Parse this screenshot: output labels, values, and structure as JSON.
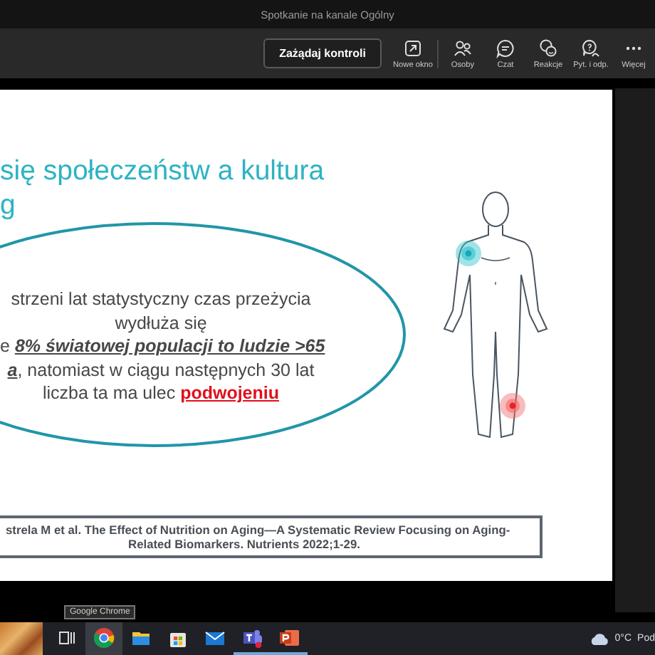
{
  "window": {
    "title": "Spotkanie na kanale Ogólny"
  },
  "toolbar": {
    "control_button": "Zażądaj kontroli",
    "actions": [
      {
        "kind": "new-window",
        "label": "Nowe okno"
      },
      {
        "kind": "people",
        "label": "Osoby"
      },
      {
        "kind": "chat",
        "label": "Czat"
      },
      {
        "kind": "reactions",
        "label": "Reakcje"
      },
      {
        "kind": "qa",
        "label": "Pyt. i odp."
      },
      {
        "kind": "more",
        "label": "Więcej"
      }
    ]
  },
  "slide": {
    "title_lines": [
      "się społeczeństw a kultura",
      "g"
    ],
    "body_lines": [
      [
        {
          "kind": "plain",
          "text": "strzeni lat statystyczny czas przeżycia"
        }
      ],
      [
        {
          "kind": "plain",
          "text": "wydłuża się"
        }
      ],
      [
        {
          "kind": "plain",
          "text": "e "
        },
        {
          "kind": "emphasis",
          "text": "8% światowej populacji to ludzie >65"
        }
      ],
      [
        {
          "kind": "emphasis",
          "text": "a"
        },
        {
          "kind": "plain",
          "text": ", natomiast w ciągu następnych 30 lat"
        }
      ],
      [
        {
          "kind": "plain",
          "text": "liczba ta ma ulec "
        },
        {
          "kind": "alert",
          "text": "podwojeniu"
        }
      ]
    ],
    "citation_lines": [
      "strela M et al.  The Effect of Nutrition on Aging—A Systematic Review Focusing on Aging-",
      "Related Biomarkers. Nutrients 2022;1-29."
    ]
  },
  "taskbar": {
    "tooltip": "Google Chrome",
    "apps": [
      {
        "kind": "task-view",
        "running": false,
        "hovered": false
      },
      {
        "kind": "chrome",
        "running": false,
        "hovered": true
      },
      {
        "kind": "explorer",
        "running": false,
        "hovered": false
      },
      {
        "kind": "store",
        "running": false,
        "hovered": false
      },
      {
        "kind": "mail",
        "running": false,
        "hovered": false
      },
      {
        "kind": "teams",
        "running": true,
        "hovered": false
      },
      {
        "kind": "powerpoint",
        "running": true,
        "hovered": false
      }
    ],
    "weather": {
      "temperature": "0°C",
      "text": "Pod"
    }
  }
}
